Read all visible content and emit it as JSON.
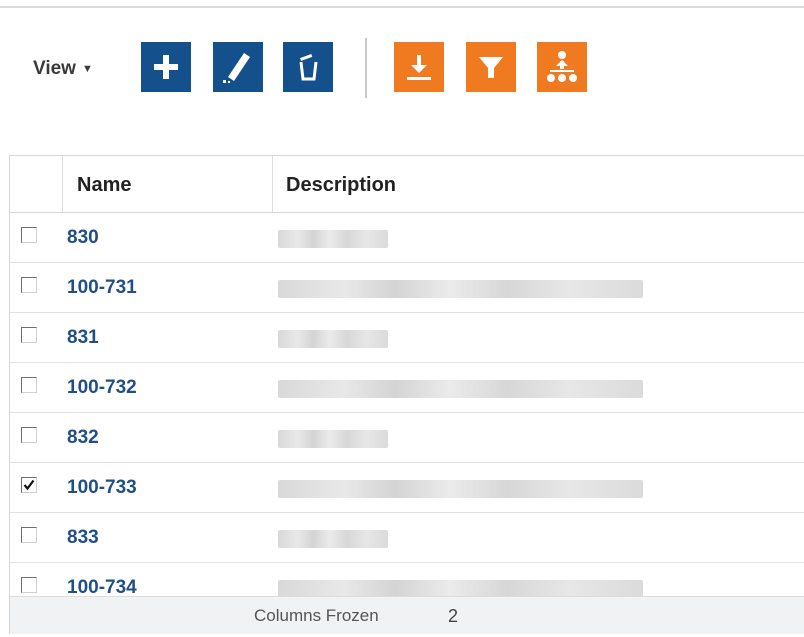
{
  "toolbar": {
    "view_label": "View",
    "buttons": [
      {
        "name": "add-button",
        "icon": "plus-icon",
        "color": "#14508c"
      },
      {
        "name": "edit-button",
        "icon": "pencil-icon",
        "color": "#14508c"
      },
      {
        "name": "delete-button",
        "icon": "trash-icon",
        "color": "#14508c"
      },
      {
        "name": "export-button",
        "icon": "download-icon",
        "color": "#f07a1f"
      },
      {
        "name": "filter-button",
        "icon": "filter-icon",
        "color": "#f07a1f"
      },
      {
        "name": "hierarchy-button",
        "icon": "hierarchy-icon",
        "color": "#f07a1f"
      }
    ]
  },
  "table": {
    "columns": [
      "Name",
      "Description"
    ],
    "rows": [
      {
        "name": "830",
        "checked": false
      },
      {
        "name": "100-731",
        "checked": false
      },
      {
        "name": "831",
        "checked": false
      },
      {
        "name": "100-732",
        "checked": false
      },
      {
        "name": "832",
        "checked": false
      },
      {
        "name": "100-733",
        "checked": true
      },
      {
        "name": "833",
        "checked": false
      },
      {
        "name": "100-734",
        "checked": false
      }
    ]
  },
  "footer": {
    "label": "Columns Frozen",
    "value": "2"
  },
  "colors": {
    "primary_blue": "#14508c",
    "accent_orange": "#f07a1f",
    "link_blue": "#1f4f86"
  }
}
